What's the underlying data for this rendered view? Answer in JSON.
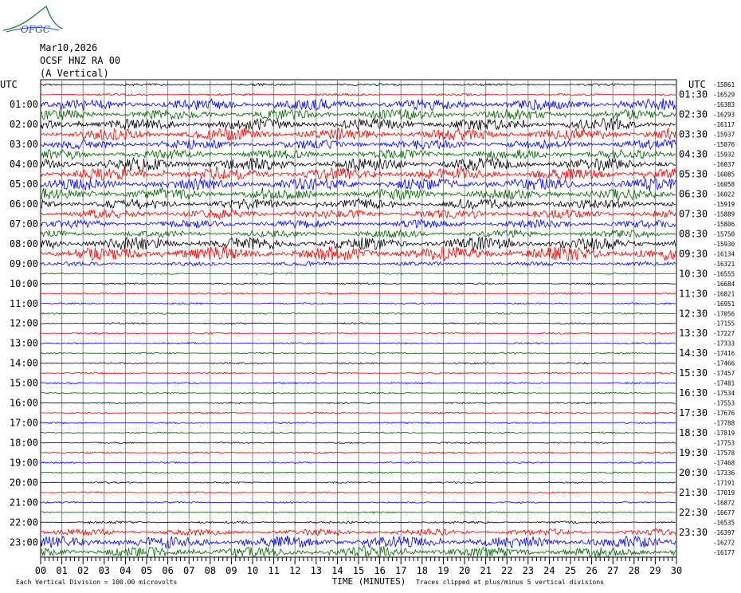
{
  "logo": {
    "text": "OFGC"
  },
  "header": {
    "date": "Mar10,2026",
    "station": "OCSF HNZ RA 00",
    "component": "(A Vertical)"
  },
  "colors": {
    "cycle": [
      "#000000",
      "#ff0000",
      "#0000ff",
      "#006400"
    ],
    "grid": "#888888"
  },
  "chart_data": {
    "type": "line",
    "left_axis_title": "UTC",
    "right_axis_title": "UTC",
    "xlabel": "TIME (MINUTES)",
    "xlim": [
      0,
      30
    ],
    "x_ticks": [
      "00",
      "01",
      "02",
      "03",
      "04",
      "05",
      "06",
      "07",
      "08",
      "09",
      "10",
      "11",
      "12",
      "13",
      "14",
      "15",
      "16",
      "17",
      "18",
      "19",
      "20",
      "21",
      "22",
      "23",
      "24",
      "25",
      "26",
      "27",
      "28",
      "29",
      "30"
    ],
    "left_hour_labels": [
      "01:00",
      "02:00",
      "03:00",
      "04:00",
      "05:00",
      "06:00",
      "07:00",
      "08:00",
      "09:00",
      "10:00",
      "11:00",
      "12:00",
      "13:00",
      "14:00",
      "15:00",
      "16:00",
      "17:00",
      "18:00",
      "19:00",
      "20:00",
      "21:00",
      "22:00",
      "23:00"
    ],
    "right_hour_labels": [
      "01:30",
      "02:30",
      "03:30",
      "04:30",
      "05:30",
      "06:30",
      "07:30",
      "08:30",
      "09:30",
      "10:30",
      "11:30",
      "12:30",
      "13:30",
      "14:30",
      "15:30",
      "16:30",
      "17:30",
      "18:30",
      "19:30",
      "20:30",
      "21:30",
      "22:30",
      "23:30"
    ],
    "trace_offsets": [
      -15861,
      -16529,
      -16383,
      -16293,
      -16117,
      -15937,
      -15876,
      -15932,
      -16037,
      -16085,
      -16058,
      -16022,
      -15919,
      -15889,
      -15806,
      -15750,
      -15930,
      -16134,
      -16321,
      -16555,
      -16684,
      -16821,
      -16951,
      -17056,
      -17155,
      -17227,
      -17333,
      -17416,
      -17466,
      -17457,
      -17481,
      -17534,
      -17553,
      -17676,
      -17788,
      -17819,
      -17753,
      -17578,
      -17468,
      -17336,
      -17191,
      -17019,
      -16872,
      -16677,
      -16535,
      -16397,
      -16272,
      -16177
    ],
    "trace_activity": [
      0.3,
      0.3,
      1.4,
      1.3,
      1.5,
      1.5,
      1.2,
      1.2,
      1.6,
      1.6,
      1.5,
      1.4,
      1.3,
      1.1,
      1.0,
      0.9,
      1.6,
      1.8,
      0.5,
      0.2,
      0.2,
      0.2,
      0.2,
      0.2,
      0.2,
      0.2,
      0.2,
      0.2,
      0.2,
      0.2,
      0.2,
      0.2,
      0.2,
      0.2,
      0.2,
      0.2,
      0.2,
      0.2,
      0.2,
      0.2,
      0.2,
      0.2,
      0.2,
      0.2,
      0.3,
      0.8,
      1.5,
      1.3
    ],
    "scale_note": "Each Vertical Division =  100.00 microvolts",
    "clip_note": "Traces clipped at plus/minus 5 vertical divisions"
  }
}
